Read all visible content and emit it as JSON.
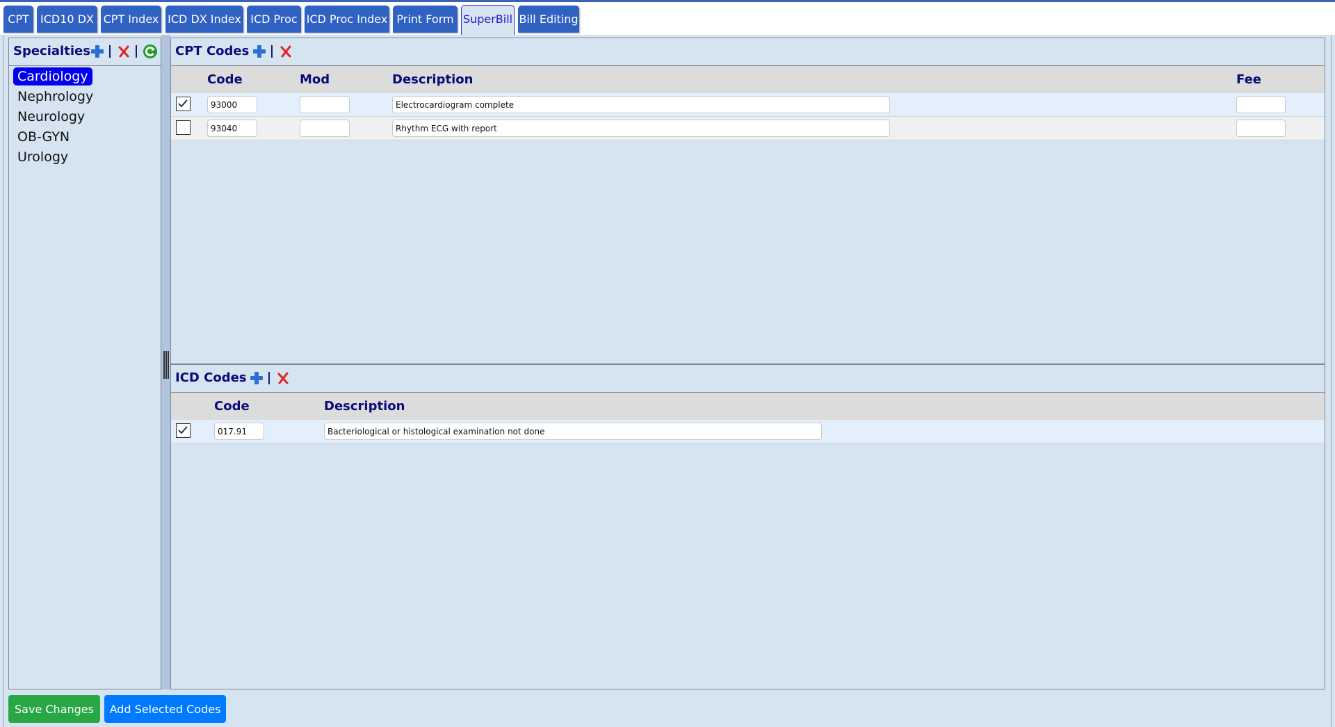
{
  "tabs": [
    {
      "label": "CPT",
      "active": false
    },
    {
      "label": "ICD10 DX",
      "active": false
    },
    {
      "label": "CPT Index",
      "active": false
    },
    {
      "label": "ICD DX Index",
      "active": false
    },
    {
      "label": "ICD Proc",
      "active": false
    },
    {
      "label": "ICD Proc Index",
      "active": false
    },
    {
      "label": "Print Form",
      "active": false
    },
    {
      "label": "SuperBill",
      "active": true
    },
    {
      "label": "Bill Editing",
      "active": false
    }
  ],
  "specialties": {
    "title": "Specialties",
    "icons": [
      "add-icon",
      "delete-icon",
      "refresh-icon"
    ],
    "items": [
      {
        "label": "Cardiology",
        "selected": true
      },
      {
        "label": "Nephrology",
        "selected": false
      },
      {
        "label": "Neurology",
        "selected": false
      },
      {
        "label": "OB-GYN",
        "selected": false
      },
      {
        "label": "Urology",
        "selected": false
      }
    ]
  },
  "cpt": {
    "title": "CPT Codes",
    "icons": [
      "add-icon",
      "delete-icon"
    ],
    "columns": {
      "code": "Code",
      "mod": "Mod",
      "description": "Description",
      "fee": "Fee"
    },
    "rows": [
      {
        "checked": true,
        "code": "93000",
        "mod": "",
        "description": "Electrocardiogram complete",
        "fee": ""
      },
      {
        "checked": false,
        "code": "93040",
        "mod": "",
        "description": "Rhythm ECG with report",
        "fee": ""
      }
    ]
  },
  "icd": {
    "title": "ICD Codes",
    "icons": [
      "add-icon",
      "delete-icon"
    ],
    "columns": {
      "code": "Code",
      "description": "Description"
    },
    "rows": [
      {
        "checked": true,
        "code": "017.91",
        "description": "Bacteriological or histological examination not done"
      }
    ]
  },
  "buttons": {
    "save": "Save Changes",
    "add_selected": "Add Selected Codes"
  },
  "colors": {
    "tab_bg": "#2f62c2",
    "selected_specialty": "#0000ee",
    "save_button": "#28a745",
    "add_button": "#007bff",
    "heading": "#0a0a78"
  }
}
